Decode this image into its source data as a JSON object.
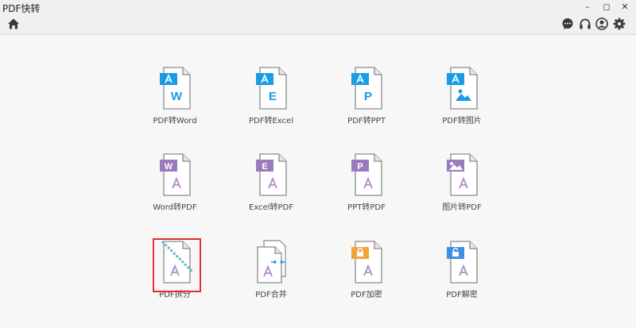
{
  "window": {
    "title": "PDF快转",
    "minimize_glyph": "–",
    "maximize_glyph": "◻",
    "close_glyph": "✕"
  },
  "toolbar": {
    "left_icon": "home-icon",
    "right_icons": [
      "chat-icon",
      "headset-icon",
      "user-icon",
      "gear-icon"
    ]
  },
  "colors": {
    "pdf_source_accent": "#1a9be8",
    "to_pdf_accent": "#9b7bbf",
    "pdf_mark": "#b58ac9",
    "lock_accent": "#f0a53a",
    "unlock_accent": "#3d8fe8",
    "selection_border": "#e0302f"
  },
  "tiles": [
    {
      "label": "PDF转Word",
      "badge": "W",
      "icon": "pdf-to-word-icon"
    },
    {
      "label": "PDF转Excel",
      "badge": "E",
      "icon": "pdf-to-excel-icon"
    },
    {
      "label": "PDF转PPT",
      "badge": "P",
      "icon": "pdf-to-ppt-icon"
    },
    {
      "label": "PDF转图片",
      "badge": "",
      "icon": "pdf-to-image-icon"
    },
    {
      "label": "Word转PDF",
      "badge": "W",
      "icon": "word-to-pdf-icon"
    },
    {
      "label": "Excel转PDF",
      "badge": "E",
      "icon": "excel-to-pdf-icon"
    },
    {
      "label": "PPT转PDF",
      "badge": "P",
      "icon": "ppt-to-pdf-icon"
    },
    {
      "label": "图片转PDF",
      "badge": "",
      "icon": "image-to-pdf-icon"
    },
    {
      "label": "PDF拆分",
      "badge": "",
      "icon": "pdf-split-icon",
      "selected": true
    },
    {
      "label": "PDF合并",
      "badge": "",
      "icon": "pdf-merge-icon"
    },
    {
      "label": "PDF加密",
      "badge": "",
      "icon": "pdf-encrypt-icon"
    },
    {
      "label": "PDF解密",
      "badge": "",
      "icon": "pdf-decrypt-icon"
    }
  ]
}
